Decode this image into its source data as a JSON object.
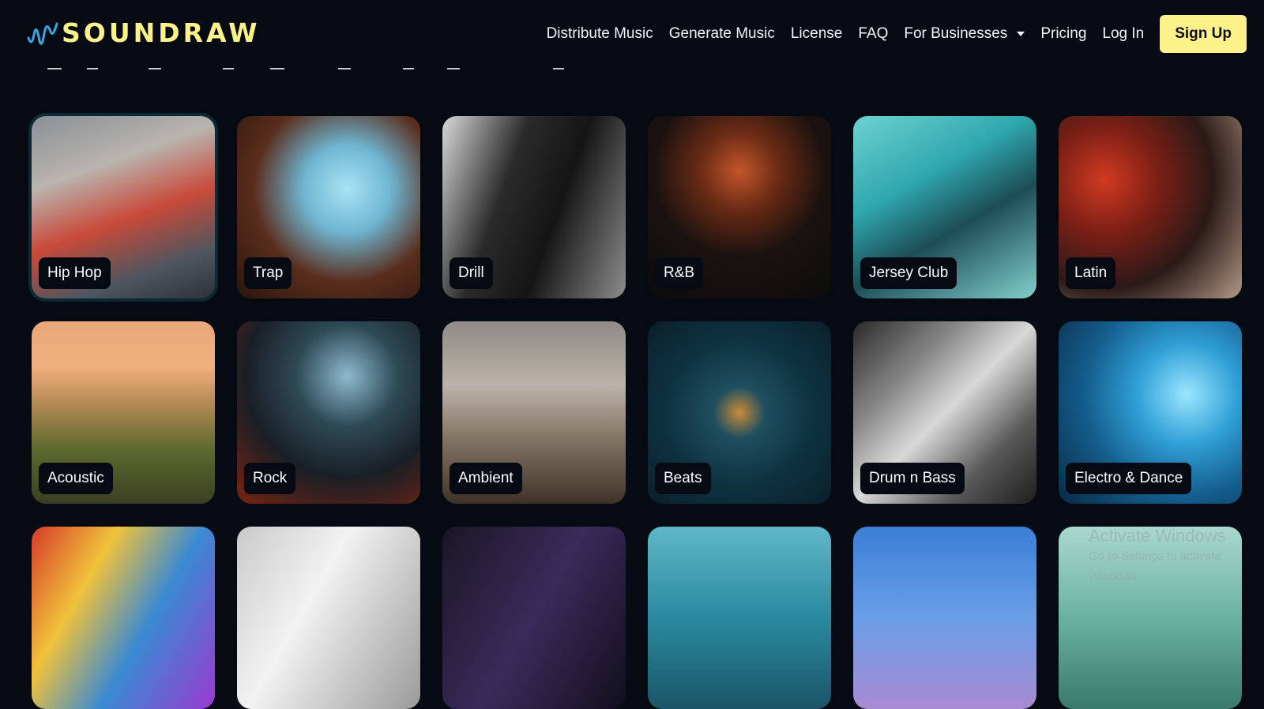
{
  "brand": {
    "name": "SOUNDRAW",
    "accent": "#fdf28a",
    "wave_color": "#3aa7e0"
  },
  "nav": {
    "items": [
      "Distribute Music",
      "Generate Music",
      "License",
      "FAQ",
      "For Businesses",
      "Pricing",
      "Log In"
    ],
    "signup_label": "Sign Up"
  },
  "genres": [
    {
      "label": "Hip Hop",
      "bg": "linear-gradient(160deg,#8a8f96 0%,#b9b4ae 30%,#c94a3a 55%,#4e5660 80%,#2e3239 100%)"
    },
    {
      "label": "Trap",
      "bg": "radial-gradient(circle at 60% 40%,#a9e2f3 0%,#6fb6d2 28%,#5a2e1d 60%,#2a150d 100%)"
    },
    {
      "label": "Drill",
      "bg": "linear-gradient(110deg,#d8d8d8 0%,#2b2b2b 35%,#151515 60%,#8d8d8d 100%)"
    },
    {
      "label": "R&B",
      "bg": "radial-gradient(circle at 50% 30%,#c4562b 0%,#6a2b15 25%,#1a1210 55%,#0c0c0c 100%)"
    },
    {
      "label": "Jersey Club",
      "bg": "linear-gradient(150deg,#6dd2cf 0%,#2fa7ae 35%,#1d4d55 60%,#82cfcc 100%)"
    },
    {
      "label": "Latin",
      "bg": "radial-gradient(circle at 25% 35%,#d23a22 0%,#7a1f16 30%,#2b1a18 60%,#b49a86 100%)"
    },
    {
      "label": "Acoustic",
      "bg": "linear-gradient(180deg,#e8a77a 0%,#f1b07e 25%,#b58a55 45%,#5d6a2e 70%,#3b3f22 100%)"
    },
    {
      "label": "Rock",
      "bg": "radial-gradient(circle at 60% 30%,#8fb9cf 0%,#2e4a56 30%,#1a1f26 60%,#7a2410 100%)"
    },
    {
      "label": "Ambient",
      "bg": "linear-gradient(180deg,#8e8a86 0%,#bcb3aa 35%,#8a7d6c 60%,#3f3328 100%)"
    },
    {
      "label": "Beats",
      "bg": "radial-gradient(circle at 50% 50%,#c98a3a 0%,#1f4f60 20%,#0f3342 55%,#0a1f2a 100%)"
    },
    {
      "label": "Drum n Bass",
      "bg": "linear-gradient(135deg,#2a2a2a 0%,#8a8a8a 30%,#d8d8d8 50%,#5a5a5a 75%,#1e1e1e 100%)"
    },
    {
      "label": "Electro & Dance",
      "bg": "radial-gradient(circle at 70% 40%,#9be6ff 0%,#2f9fd6 30%,#155e8e 60%,#082a44 100%)"
    },
    {
      "label": "",
      "bg": "linear-gradient(120deg,#d63a2a 0%,#f0c23a 30%,#3a8ad2 60%,#9b3ad2 100%)"
    },
    {
      "label": "",
      "bg": "linear-gradient(120deg,#c9c9c9 0%,#f2f2f2 40%,#9a9a9a 100%)"
    },
    {
      "label": "",
      "bg": "linear-gradient(120deg,#1a1726 0%,#3b2a5a 50%,#120f1d 100%)"
    },
    {
      "label": "",
      "bg": "linear-gradient(180deg,#5fb7c8 0%,#2a8aa0 50%,#1b5566 100%)"
    },
    {
      "label": "",
      "bg": "linear-gradient(180deg,#3a7fd6 0%,#6a9ee8 50%,#a88ad2 100%)"
    },
    {
      "label": "",
      "bg": "linear-gradient(180deg,#a9d8cc 0%,#6ab2a0 50%,#3a7a6a 100%)"
    }
  ],
  "watermark": {
    "title": "Activate Windows",
    "sub": "Go to Settings to activate Windows."
  }
}
